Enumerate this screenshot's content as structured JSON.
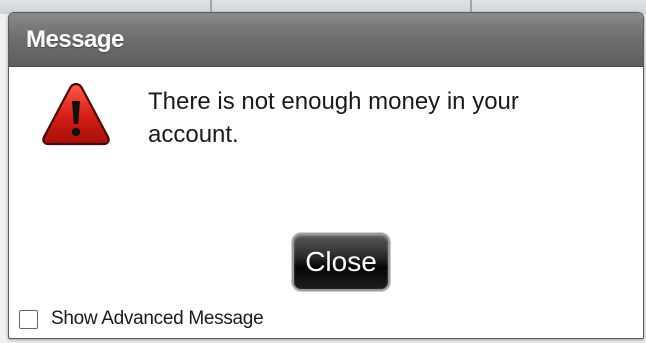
{
  "dialog": {
    "title": "Message",
    "icon": "warning-icon",
    "message": "There is not enough money in your account.",
    "close_label": "Close",
    "advanced_label": "Show Advanced Message",
    "advanced_checked": false
  },
  "colors": {
    "titlebar": "#6f6f6f",
    "icon_red": "#d42020",
    "button": "#111111"
  }
}
